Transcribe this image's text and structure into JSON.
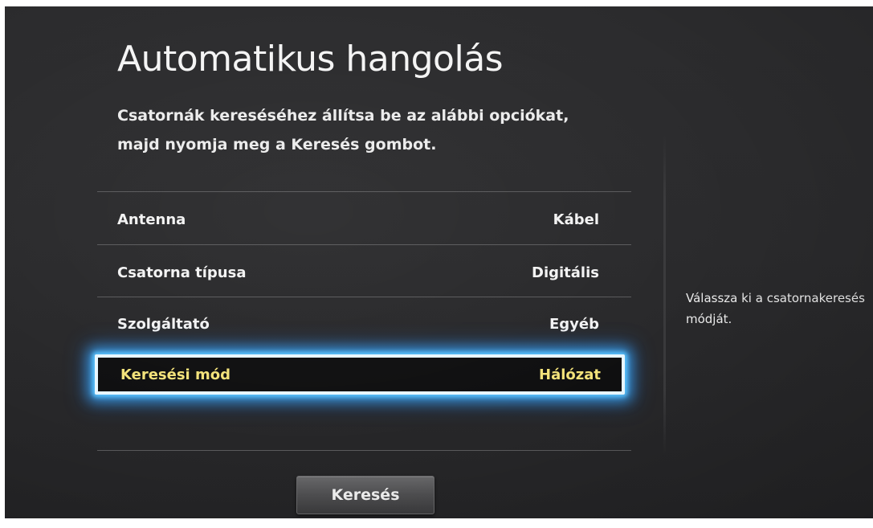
{
  "page": {
    "title": "Automatikus hangolás",
    "subtitle": "Csatornák kereséséhez állítsa be az alábbi opciókat, majd nyomja meg a Keresés gombot."
  },
  "settings": [
    {
      "label": "Antenna",
      "value": "Kábel"
    },
    {
      "label": "Csatorna típusa",
      "value": "Digitális"
    },
    {
      "label": "Szolgáltató",
      "value": "Egyéb"
    },
    {
      "label": "Keresési mód",
      "value": "Hálózat",
      "selected": true
    }
  ],
  "help": {
    "line1": "Válassza ki a csatornakeresés",
    "line2": "módját."
  },
  "actions": {
    "search_label": "Keresés"
  },
  "colors": {
    "background": "#2a2a2c",
    "selected_text": "#f3e27a",
    "focus_glow": "#3caaff"
  }
}
